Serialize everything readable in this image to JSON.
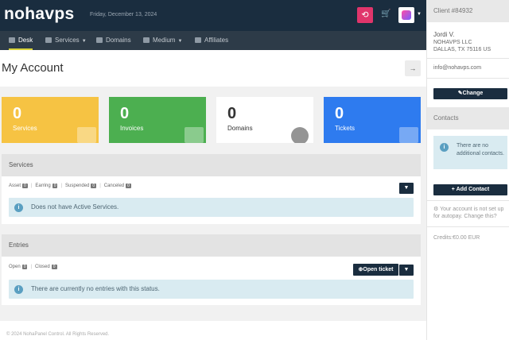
{
  "header": {
    "logo": "nohavps",
    "date": "Friday, December 13, 2024",
    "refresh_icon": "refresh-icon",
    "cart_icon": "cart-icon"
  },
  "nav": [
    {
      "label": "Desk",
      "icon": "desk-icon",
      "active": true,
      "dropdown": false
    },
    {
      "label": "Services",
      "icon": "cart-icon",
      "active": false,
      "dropdown": true
    },
    {
      "label": "Domains",
      "icon": "domains-icon",
      "active": false,
      "dropdown": false
    },
    {
      "label": "Medium",
      "icon": "medium-icon",
      "active": false,
      "dropdown": true
    },
    {
      "label": "Affiliates",
      "icon": "affiliates-icon",
      "active": false,
      "dropdown": false
    }
  ],
  "page": {
    "title": "My Account",
    "title_button_icon": "arrow-right-icon"
  },
  "stats": [
    {
      "value": "0",
      "label": "Services",
      "color": "#f6c343"
    },
    {
      "value": "0",
      "label": "Invoices",
      "color": "#4caf50"
    },
    {
      "value": "0",
      "label": "Domains",
      "color": "#ffffff"
    },
    {
      "value": "0",
      "label": "Tickets",
      "color": "#2e7bef"
    }
  ],
  "services": {
    "heading": "Services",
    "filters": [
      {
        "label": "Asset",
        "count": "0"
      },
      {
        "label": "Earring",
        "count": "0"
      },
      {
        "label": "Suspended",
        "count": "0"
      },
      {
        "label": "Canceled",
        "count": "0"
      }
    ],
    "info": "Does not have Active Services."
  },
  "entries": {
    "heading": "Entries",
    "filters": [
      {
        "label": "Open",
        "count": "0"
      },
      {
        "label": "Closed",
        "count": "0"
      }
    ],
    "open_ticket": "Open ticket",
    "info": "There are currently no entries with this status."
  },
  "footer": "© 2024 NohaPanel Control. All Rights Reserved.",
  "sidebar": {
    "client_heading": "Client #84932",
    "name": "Jordi V.",
    "company": "NOHAVPS LLC",
    "address": "DALLAS, TX 75116 US",
    "email": "info@nohavps.com",
    "change_label": "Change",
    "contacts_heading": "Contacts",
    "contacts_info": "There are no additional contacts.",
    "add_contact_label": "+ Add Contact",
    "autopay_text": "Your account is not set up for autopay. Change this?",
    "credits": "Credits:€0.00 EUR"
  },
  "colors": {
    "topbar": "#1a2d3f",
    "nav": "#2d3b48",
    "accent_pink": "#e0356b",
    "nav_active_underline": "#d7d23a"
  }
}
